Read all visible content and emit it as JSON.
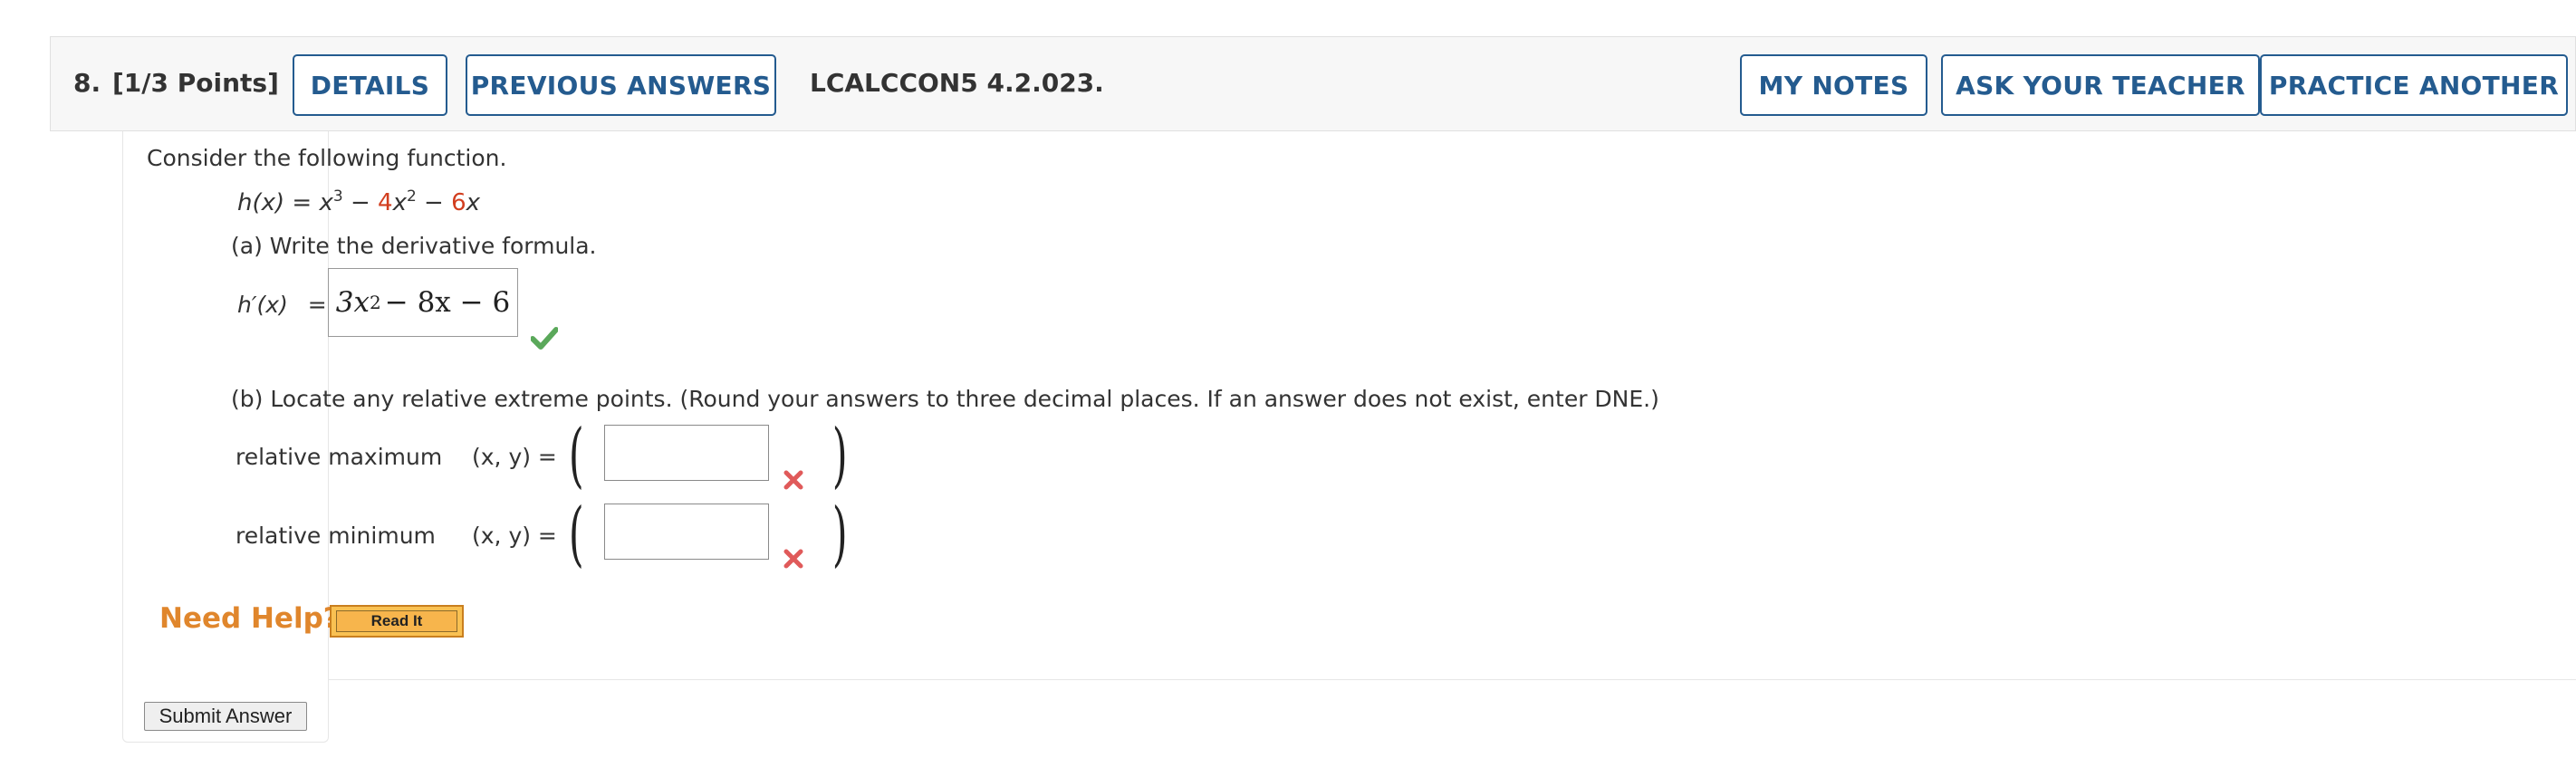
{
  "header": {
    "question_number": "8.",
    "points": "[1/3 Points]",
    "details_label": "DETAILS",
    "previous_answers_label": "PREVIOUS ANSWERS",
    "question_code": "LCALCCON5 4.2.023.",
    "my_notes_label": "MY NOTES",
    "ask_teacher_label": "ASK YOUR TEACHER",
    "practice_another_label": "PRACTICE ANOTHER"
  },
  "problem": {
    "intro": "Consider the following function.",
    "function": {
      "lhs": "h(x) = x",
      "exp1": "3",
      "minus1": " − ",
      "coef1": "4",
      "term2": "x",
      "exp2": "2",
      "minus2": " − ",
      "coef2": "6",
      "term3": "x"
    },
    "part_a": {
      "prompt": "(a) Write the derivative formula.",
      "label": "h′(x)",
      "equals": "=",
      "answer_base": "3x",
      "answer_exp": "2",
      "answer_rest": " − 8x − 6",
      "status": "correct"
    },
    "part_b": {
      "prompt": "(b) Locate any relative extreme points. (Round your answers to three decimal places. If an answer does not exist, enter DNE.)",
      "coord_label": "(x, y) =",
      "max_label": "relative maximum",
      "min_label": "relative minimum",
      "max_value": "",
      "min_value": "",
      "max_status": "incorrect",
      "min_status": "incorrect"
    }
  },
  "help": {
    "need_help": "Need Help?",
    "read_it": "Read It"
  },
  "submit_label": "Submit Answer",
  "colors": {
    "accent": "#245b8f",
    "highlight_red": "#d23e1f",
    "correct_green": "#5aa85a",
    "incorrect_red": "#e05a5a",
    "need_help_orange": "#e0862c"
  }
}
